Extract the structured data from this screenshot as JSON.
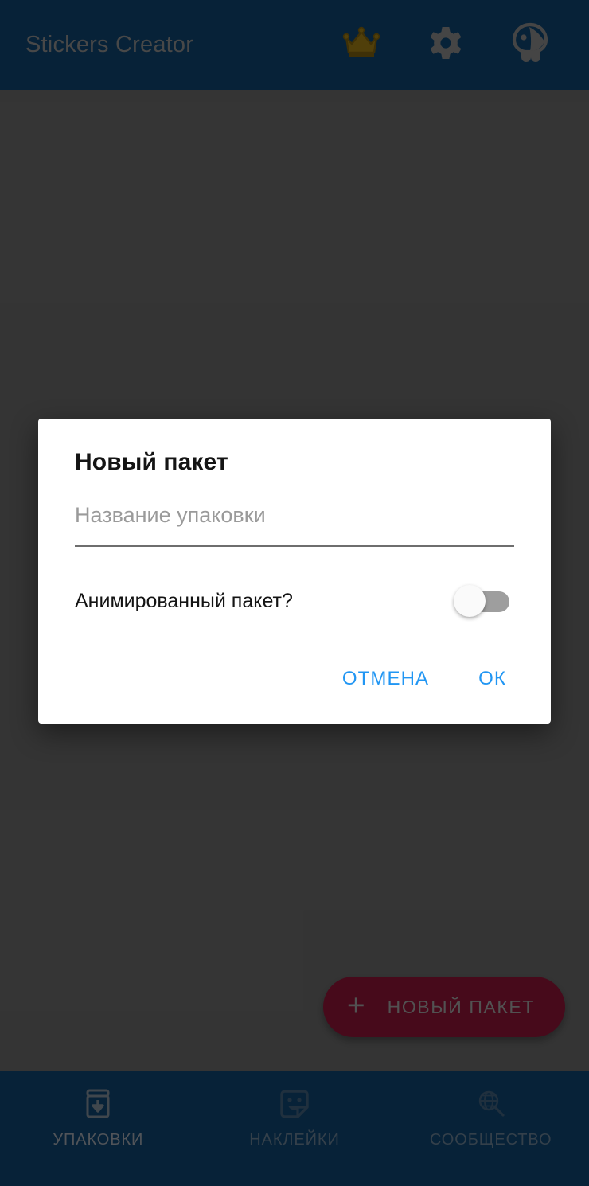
{
  "appbar": {
    "title": "Stickers Creator",
    "actions": [
      {
        "name": "crown-icon",
        "label": "Premium"
      },
      {
        "name": "gear-icon",
        "label": "Settings"
      },
      {
        "name": "mascot-icon",
        "label": "Mascot"
      }
    ]
  },
  "fab": {
    "plus": "+",
    "label": "НОВЫЙ ПАКЕТ",
    "color": "#7b1230"
  },
  "bottom_nav": {
    "items": [
      {
        "label": "УПАКОВКИ",
        "icon": "package-download-icon",
        "active": true
      },
      {
        "label": "НАКЛЕЙКИ",
        "icon": "sticker-smiley-icon",
        "active": false
      },
      {
        "label": "СООБЩЕСТВО",
        "icon": "globe-search-icon",
        "active": false
      }
    ]
  },
  "dialog": {
    "title": "Новый пакет",
    "input": {
      "value": "",
      "placeholder": "Название упаковки"
    },
    "switch": {
      "label": "Анимированный пакет?",
      "checked": false
    },
    "buttons": {
      "cancel": "ОТМЕНА",
      "ok": "ОК"
    },
    "accent_color": "#2196f3"
  },
  "theme": {
    "appbar_bg": "#0d3c61",
    "scrim_bg": "#5b5b5b",
    "dialog_bg": "#ffffff",
    "crown_color": "#8a6d12"
  }
}
